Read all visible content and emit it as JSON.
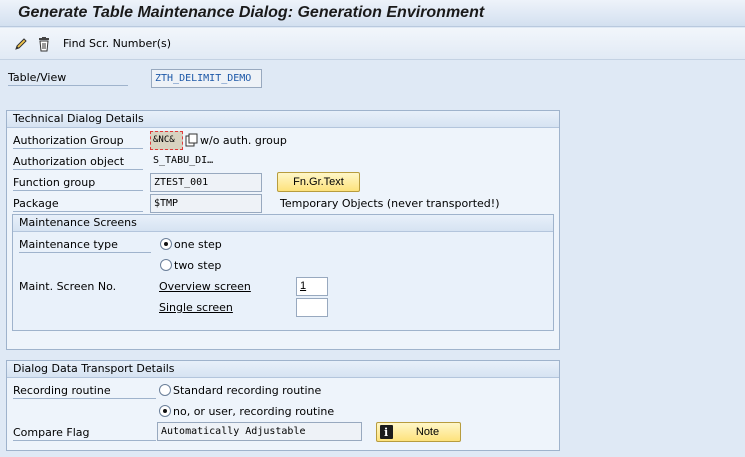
{
  "window": {
    "title": "Generate Table Maintenance Dialog: Generation Environment"
  },
  "toolbar": {
    "edit_icon": "pencil-icon",
    "delete_icon": "trash-icon",
    "find_screen_label": "Find Scr. Number(s)"
  },
  "table_view": {
    "label": "Table/View",
    "value": "ZTH_DELIMIT_DEMO"
  },
  "technical": {
    "header": "Technical Dialog Details",
    "auth_group_label": "Authorization Group",
    "auth_group_value": "&NC&",
    "auth_group_desc": "w/o auth. group",
    "auth_object_label": "Authorization object",
    "auth_object_value": "S_TABU_DI…",
    "function_group_label": "Function group",
    "function_group_value": "ZTEST_001",
    "function_group_button": "Fn.Gr.Text",
    "package_label": "Package",
    "package_value": "$TMP",
    "package_desc": "Temporary Objects (never transported!)"
  },
  "maint_screens": {
    "header": "Maintenance Screens",
    "type_label": "Maintenance type",
    "one_step": "one step",
    "two_step": "two step",
    "selected": "one step",
    "screen_no_label": "Maint. Screen No.",
    "overview_label": "Overview screen",
    "overview_value": "1",
    "single_label": "Single screen",
    "single_value": ""
  },
  "transport": {
    "header": "Dialog Data Transport Details",
    "recording_label": "Recording routine",
    "standard_option": "Standard recording routine",
    "user_option": "no, or user, recording routine",
    "selected": "no, or user, recording routine",
    "compare_label": "Compare Flag",
    "compare_value": "Automatically Adjustable",
    "note_button": "Note",
    "note_icon": "info-icon"
  }
}
